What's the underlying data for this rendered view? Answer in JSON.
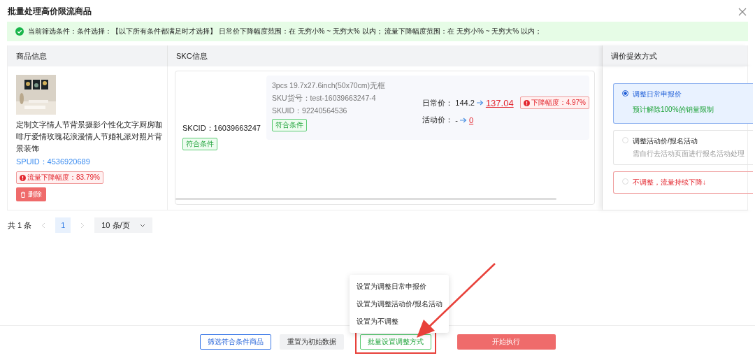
{
  "dialog": {
    "title": "批量处理高价限流商品"
  },
  "filter_banner": {
    "text": "当前筛选条件：条件选择：【以下所有条件都满足时才选择】 日常价下降幅度范围：在 无穷小% ~ 无穷大% 以内； 流量下降幅度范围：在 无穷小% ~ 无穷大% 以内；"
  },
  "table": {
    "columns": [
      "商品信息",
      "SKC信息"
    ],
    "product": {
      "kind": "picture",
      "title": "定制文字情人节背景摄影个性化文字厨房咖啡厅爱情玫瑰花浪漫情人节婚礼派对照片背景装饰",
      "spuid": "SPUID：4536920689",
      "traffic_badge": "流量下降幅度：83.79%",
      "delete_button": "删除"
    },
    "skc": {
      "skcid": "SKCID：16039663247",
      "tag": "符合条件",
      "skus": [
        {
          "name": "3pcs 19.7x27.6inch(50x70cm)无框",
          "sku_no": "SKU货号：test-16039663247-4",
          "skuid": "SKUID：92240564536",
          "tag": "符合条件",
          "daily_label": "日常价：",
          "daily_from": "144.2",
          "daily_to": "137.04",
          "drop_badge": "下降幅度：4.97%",
          "activity_label": "活动价：",
          "activity_from": "-",
          "activity_to": "0"
        }
      ]
    }
  },
  "adjust_panel": {
    "title": "调价提效方式",
    "options": [
      {
        "kind": "recommend",
        "label": "调整日常申报价",
        "note": "预计解除100%的销量限制",
        "selected": true
      },
      {
        "kind": "normal",
        "label": "调整活动价/报名活动",
        "note": "需自行去活动页面进行报名活动处理",
        "selected": false
      },
      {
        "kind": "warning",
        "label": "不调整，流量持续下降↓",
        "selected": false
      }
    ]
  },
  "pagination": {
    "total": "共 1 条",
    "pages": [
      {
        "label": "1",
        "selected": true
      }
    ],
    "page_size": "10 条/页"
  },
  "dropdown_menu": {
    "items": [
      "设置为调整日常申报价",
      "设置为调整活动价/报名活动",
      "设置为不调整"
    ]
  },
  "footer": {
    "buttons": [
      {
        "kind": "outline",
        "label": "筛选符合条件商品",
        "highlighted": false
      },
      {
        "kind": "gray",
        "label": "重置为初始数据",
        "highlighted": false
      },
      {
        "kind": "success",
        "label": "批量设置调整方式",
        "highlighted": true
      },
      {
        "kind": "danger",
        "label": "开始执行",
        "highlighted": false
      }
    ]
  }
}
